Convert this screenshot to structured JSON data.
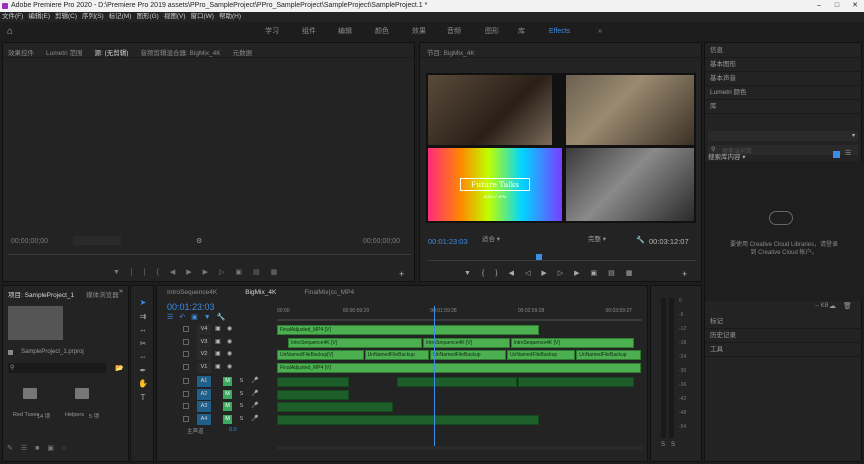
{
  "title_bar": {
    "app": "Adobe Premiere Pro 2020 - D:\\Premiere Pro 2019 assets\\PPro_SampleProject\\PPro_SampleProject\\SampleProject\\SampleProject.1 *"
  },
  "menu": [
    "文件(F)",
    "编辑(E)",
    "剪辑(C)",
    "序列(S)",
    "标记(M)",
    "图形(G)",
    "视图(V)",
    "窗口(W)",
    "帮助(H)"
  ],
  "workspaces": [
    "学习",
    "组件",
    "编辑",
    "颜色",
    "效果",
    "音频",
    "图形",
    "库",
    "Effects",
    "»"
  ],
  "source_panel": {
    "tabs": [
      "效果控件",
      "Lumetri 范围",
      "源: (无剪辑)",
      "音频剪辑混合器: BigMix_4K",
      "元数据"
    ],
    "tc_left": "00;00;00;00",
    "tc_right": "00;00;00;00"
  },
  "program_panel": {
    "tab": "节目: BigMix_4K",
    "tc_left": "00:01:23:03",
    "fit": "适合",
    "quality": "完整",
    "tc_right": "00:03:12:07",
    "title_text": "Future Talks",
    "subtitle_text": "6/15/17  4PM"
  },
  "right_panel": {
    "items": [
      "信息",
      "基本图形",
      "基本声音",
      "Lumetri 颜色",
      "库"
    ],
    "library_select": "",
    "search_placeholder": "搜索当前库",
    "filter_label": "搜索库内容 ▾",
    "cc_text_1": "要使用 Creative Cloud Libraries，请登录",
    "cc_text_2": "到 Creative Cloud 帐户。",
    "size_label": "-- KB",
    "lower_items": [
      "标记",
      "历史记录",
      "工具"
    ]
  },
  "project_panel": {
    "tabs": [
      "项目: SampleProject_1",
      "媒体浏览器"
    ],
    "file": "SampleProject_1.prproj",
    "bins": [
      {
        "name": "Red Tuxes",
        "count": "14 项"
      },
      {
        "name": "Helpers",
        "count": "5 项"
      }
    ]
  },
  "timeline": {
    "tabs": [
      "IntroSequence4K",
      "BigMix_4K",
      "FinalMix(cc_MP4"
    ],
    "tc": "00:01:23:03",
    "ruler": [
      "00:00",
      "00:00:59:29",
      "00:01:59:28",
      "00:02:59:28",
      "00:03:59:27"
    ],
    "ruler_frac": [
      0.0,
      0.18,
      0.42,
      0.66,
      0.9
    ],
    "playhead_frac": 0.43,
    "video_tracks": [
      {
        "name": "V4",
        "clips": [
          {
            "label": "FinalAdjusted_MP4 [V]",
            "s": 0.0,
            "e": 0.72,
            "light": true
          }
        ]
      },
      {
        "name": "V3",
        "clips": [
          {
            "label": "IntroSequence4K [V]",
            "s": 0.03,
            "e": 0.4,
            "light": true
          },
          {
            "label": "IntroSequence4K [V]",
            "s": 0.4,
            "e": 0.64,
            "light": true
          },
          {
            "label": "IntroSequence4K [V]",
            "s": 0.64,
            "e": 0.98,
            "light": true
          }
        ]
      },
      {
        "name": "V2",
        "clips": [
          {
            "label": "UnNamedFileBackup[V]",
            "s": 0.0,
            "e": 0.24,
            "light": true
          },
          {
            "label": "UnNamedFileBackup",
            "s": 0.24,
            "e": 0.42,
            "light": true
          },
          {
            "label": "UnNamedFileBackup",
            "s": 0.42,
            "e": 0.63,
            "light": true
          },
          {
            "label": "UnNamedFileBackup",
            "s": 0.63,
            "e": 0.82,
            "light": true
          },
          {
            "label": "UnNamedFileBackup",
            "s": 0.82,
            "e": 1.0,
            "light": true
          }
        ]
      },
      {
        "name": "V1",
        "clips": [
          {
            "label": "FinalAdjusted_MP4 [V]",
            "s": 0.0,
            "e": 1.0,
            "light": true
          }
        ]
      }
    ],
    "audio_tracks": [
      {
        "name": "A1",
        "clips": [
          {
            "s": 0.0,
            "e": 0.2
          },
          {
            "s": 0.33,
            "e": 0.66
          },
          {
            "s": 0.66,
            "e": 0.98
          }
        ]
      },
      {
        "name": "A2",
        "clips": [
          {
            "s": 0.0,
            "e": 0.2
          }
        ]
      },
      {
        "name": "A3",
        "clips": [
          {
            "s": 0.0,
            "e": 0.32
          }
        ]
      },
      {
        "name": "A4",
        "clips": [
          {
            "s": 0.0,
            "e": 0.72
          }
        ]
      }
    ],
    "master_label": "主声道",
    "master_val": "0.0"
  },
  "meter": {
    "labels": [
      "0",
      "-6",
      "-12",
      "-18",
      "-24",
      "-30",
      "-36",
      "-42",
      "-48",
      "-54"
    ]
  },
  "colors": {
    "accent": "#3b8ee8",
    "clip_video": "#4caf50",
    "clip_audio": "#1e5e2a"
  }
}
